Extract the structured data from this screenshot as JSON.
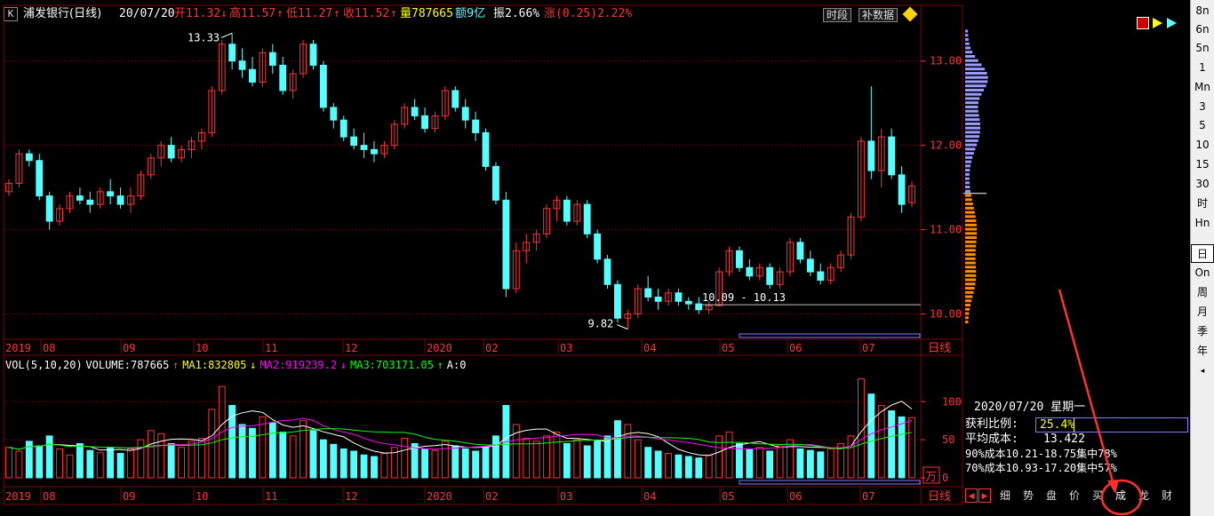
{
  "header": {
    "k_badge": "K",
    "stock_title": "浦发银行(日线)",
    "date": "20/07/20",
    "open_label": "开",
    "open_value": "11.32",
    "high_label": "高",
    "high_value": "11.57",
    "low_label": "低",
    "low_value": "11.27",
    "close_label": "收",
    "close_value": "11.52",
    "volume_label": "量",
    "volume_value": "787665",
    "amount_label": "额9亿",
    "amplitude_label": "振",
    "amplitude_value": "2.66%",
    "change_label": "涨",
    "change_value": "(0.25)2.22%",
    "btn_period": "时段",
    "btn_supplement": "补数据"
  },
  "price_axis": {
    "ticks": [
      "13.00",
      "12.00",
      "11.00",
      "10.00"
    ],
    "max_annotation": "13.33",
    "min_annotation": "9.82",
    "range_annotation": "10.09 - 10.13"
  },
  "time_axis": {
    "labels": [
      "2019",
      "08",
      "09",
      "10",
      "11",
      "12",
      "2020",
      "02",
      "03",
      "04",
      "05",
      "06",
      "07"
    ],
    "period_label": "日线"
  },
  "volume_header": {
    "vol_label": "VOL(5,10,20)",
    "volume_text": "VOLUME:787665",
    "ma1": "MA1:832805",
    "ma2": "MA2:919239.2",
    "ma3": "MA3:703171.05",
    "a0": "A:0",
    "up_arrow": "↑",
    "down_arrow": "↓"
  },
  "volume_axis": {
    "ticks": [
      "100",
      "50",
      "0"
    ],
    "unit": "万"
  },
  "cost_panel": {
    "date_line": "2020/07/20 星期一",
    "profit_label": "获利比例:",
    "profit_value": "25.4%",
    "avg_cost_label": "平均成本:",
    "avg_cost_value": "13.422",
    "line_90": "90%成本10.21-18.75集中78%",
    "line_70": "70%成本10.93-17.20集中57%"
  },
  "bottom_tabs": [
    "细",
    "势",
    "盘",
    "价",
    "买",
    "成",
    "龙",
    "财"
  ],
  "right_toolbar": [
    "8n",
    "6n",
    "5n",
    "1",
    "Mn",
    "3",
    "5",
    "10",
    "15",
    "30",
    "时",
    "Hn",
    "日",
    "On",
    "周",
    "月",
    "季",
    "年"
  ],
  "right_toolbar_selected": "日",
  "colors": {
    "up": "#ff3232",
    "down": "#54ffff",
    "ma1": "#ffffff",
    "ma2": "#ff00ff",
    "ma3": "#00ff00",
    "grid": "#800000",
    "profile_profit": "#ff8c00",
    "profile_loss": "#9b9bff",
    "annotation_red": "#ff3030"
  },
  "chart_data": {
    "type": "candlestick",
    "ylim": [
      9.7,
      13.45
    ],
    "x_labels": [
      "2019",
      "08",
      "09",
      "10",
      "11",
      "12",
      "2020",
      "02",
      "03",
      "04",
      "05",
      "06",
      "07"
    ],
    "candles": [
      [
        11.45,
        11.6,
        11.4,
        11.55
      ],
      [
        11.55,
        11.95,
        11.5,
        11.9
      ],
      [
        11.9,
        11.95,
        11.75,
        11.82
      ],
      [
        11.82,
        11.9,
        11.35,
        11.4
      ],
      [
        11.4,
        11.45,
        11.0,
        11.1
      ],
      [
        11.1,
        11.3,
        11.05,
        11.25
      ],
      [
        11.25,
        11.45,
        11.2,
        11.4
      ],
      [
        11.4,
        11.5,
        11.3,
        11.35
      ],
      [
        11.35,
        11.45,
        11.2,
        11.3
      ],
      [
        11.3,
        11.5,
        11.25,
        11.45
      ],
      [
        11.45,
        11.6,
        11.3,
        11.4
      ],
      [
        11.4,
        11.5,
        11.25,
        11.3
      ],
      [
        11.3,
        11.5,
        11.2,
        11.4
      ],
      [
        11.4,
        11.7,
        11.35,
        11.65
      ],
      [
        11.65,
        11.9,
        11.6,
        11.85
      ],
      [
        11.85,
        12.05,
        11.75,
        12.0
      ],
      [
        12.0,
        12.1,
        11.8,
        11.85
      ],
      [
        11.85,
        12.0,
        11.8,
        11.95
      ],
      [
        11.95,
        12.1,
        11.85,
        12.05
      ],
      [
        12.05,
        12.2,
        11.95,
        12.15
      ],
      [
        12.15,
        12.7,
        12.1,
        12.65
      ],
      [
        12.65,
        13.25,
        12.6,
        13.2
      ],
      [
        13.2,
        13.33,
        12.9,
        13.0
      ],
      [
        13.0,
        13.15,
        12.8,
        12.9
      ],
      [
        12.9,
        13.05,
        12.7,
        12.75
      ],
      [
        12.75,
        13.15,
        12.7,
        13.1
      ],
      [
        13.1,
        13.2,
        12.85,
        12.95
      ],
      [
        12.95,
        13.05,
        12.6,
        12.65
      ],
      [
        12.65,
        12.9,
        12.55,
        12.85
      ],
      [
        12.85,
        13.25,
        12.8,
        13.2
      ],
      [
        13.2,
        13.25,
        12.9,
        12.95
      ],
      [
        12.95,
        13.0,
        12.4,
        12.45
      ],
      [
        12.45,
        12.5,
        12.2,
        12.3
      ],
      [
        12.3,
        12.35,
        12.05,
        12.1
      ],
      [
        12.1,
        12.2,
        11.95,
        12.0
      ],
      [
        12.0,
        12.15,
        11.85,
        11.95
      ],
      [
        11.95,
        12.05,
        11.8,
        11.9
      ],
      [
        11.9,
        12.05,
        11.85,
        12.0
      ],
      [
        12.0,
        12.3,
        11.95,
        12.25
      ],
      [
        12.25,
        12.5,
        12.2,
        12.45
      ],
      [
        12.45,
        12.55,
        12.3,
        12.35
      ],
      [
        12.35,
        12.45,
        12.15,
        12.2
      ],
      [
        12.2,
        12.4,
        12.15,
        12.35
      ],
      [
        12.35,
        12.7,
        12.3,
        12.65
      ],
      [
        12.65,
        12.7,
        12.4,
        12.45
      ],
      [
        12.45,
        12.55,
        12.2,
        12.3
      ],
      [
        12.3,
        12.4,
        12.05,
        12.15
      ],
      [
        12.15,
        12.2,
        11.7,
        11.75
      ],
      [
        11.75,
        11.8,
        11.3,
        11.35
      ],
      [
        11.35,
        11.45,
        10.2,
        10.3
      ],
      [
        10.3,
        10.85,
        10.25,
        10.75
      ],
      [
        10.75,
        10.95,
        10.6,
        10.85
      ],
      [
        10.85,
        11.0,
        10.75,
        10.95
      ],
      [
        10.95,
        11.3,
        10.9,
        11.25
      ],
      [
        11.25,
        11.4,
        11.1,
        11.35
      ],
      [
        11.35,
        11.4,
        11.05,
        11.1
      ],
      [
        11.1,
        11.35,
        11.05,
        11.3
      ],
      [
        11.3,
        11.35,
        10.9,
        10.95
      ],
      [
        10.95,
        11.0,
        10.6,
        10.65
      ],
      [
        10.65,
        10.7,
        10.3,
        10.35
      ],
      [
        10.35,
        10.4,
        9.9,
        9.95
      ],
      [
        9.95,
        10.05,
        9.82,
        10.0
      ],
      [
        10.0,
        10.35,
        9.95,
        10.3
      ],
      [
        10.3,
        10.45,
        10.15,
        10.2
      ],
      [
        10.2,
        10.3,
        10.05,
        10.15
      ],
      [
        10.15,
        10.3,
        10.1,
        10.25
      ],
      [
        10.25,
        10.3,
        10.1,
        10.15
      ],
      [
        10.15,
        10.2,
        10.05,
        10.12
      ],
      [
        10.12,
        10.2,
        10.0,
        10.05
      ],
      [
        10.05,
        10.15,
        10.0,
        10.1
      ],
      [
        10.1,
        10.55,
        10.09,
        10.5
      ],
      [
        10.5,
        10.8,
        10.45,
        10.75
      ],
      [
        10.75,
        10.8,
        10.5,
        10.55
      ],
      [
        10.55,
        10.65,
        10.4,
        10.45
      ],
      [
        10.45,
        10.6,
        10.4,
        10.55
      ],
      [
        10.55,
        10.6,
        10.3,
        10.35
      ],
      [
        10.35,
        10.55,
        10.3,
        10.5
      ],
      [
        10.5,
        10.9,
        10.45,
        10.85
      ],
      [
        10.85,
        10.9,
        10.6,
        10.65
      ],
      [
        10.65,
        10.75,
        10.45,
        10.5
      ],
      [
        10.5,
        10.6,
        10.35,
        10.4
      ],
      [
        10.4,
        10.6,
        10.35,
        10.55
      ],
      [
        10.55,
        10.75,
        10.5,
        10.7
      ],
      [
        10.7,
        11.2,
        10.65,
        11.15
      ],
      [
        11.15,
        12.1,
        11.1,
        12.05
      ],
      [
        12.05,
        12.7,
        11.6,
        11.7
      ],
      [
        11.7,
        12.2,
        11.5,
        12.1
      ],
      [
        12.1,
        12.2,
        11.6,
        11.65
      ],
      [
        11.65,
        11.75,
        11.2,
        11.3
      ],
      [
        11.32,
        11.57,
        11.27,
        11.52
      ]
    ],
    "volume_ylim": [
      0,
      140
    ],
    "volumes": [
      40,
      35,
      48,
      42,
      55,
      38,
      30,
      45,
      36,
      33,
      40,
      32,
      38,
      50,
      62,
      58,
      45,
      40,
      48,
      52,
      90,
      120,
      95,
      70,
      65,
      80,
      72,
      60,
      55,
      75,
      62,
      50,
      44,
      38,
      35,
      30,
      28,
      32,
      40,
      52,
      45,
      38,
      36,
      48,
      42,
      38,
      35,
      40,
      55,
      95,
      70,
      52,
      48,
      55,
      60,
      45,
      50,
      42,
      48,
      55,
      75,
      70,
      50,
      40,
      35,
      32,
      30,
      28,
      26,
      30,
      55,
      60,
      45,
      38,
      40,
      35,
      42,
      50,
      38,
      36,
      34,
      38,
      45,
      55,
      130,
      110,
      95,
      88,
      80,
      79
    ]
  }
}
